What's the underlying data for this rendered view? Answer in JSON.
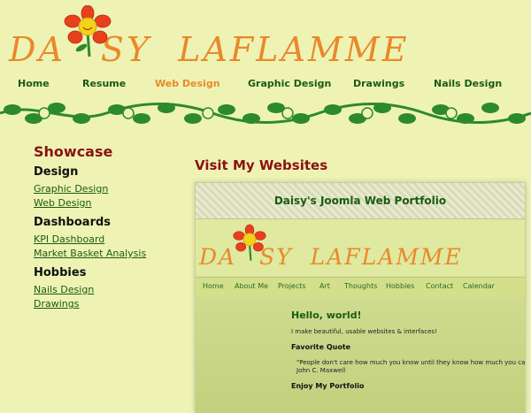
{
  "logo": {
    "part1": "DA",
    "part2": "SY",
    "part3": "LAFLAMME"
  },
  "nav": [
    {
      "label": "Home"
    },
    {
      "label": "Resume"
    },
    {
      "label": "Web Design"
    },
    {
      "label": "Graphic Design"
    },
    {
      "label": "Drawings"
    },
    {
      "label": "Nails Design"
    }
  ],
  "colors": {
    "background": "#eef3b4",
    "accent": "#e9892a",
    "link": "#1a5b12",
    "heading": "#8a1212"
  },
  "sidebar": {
    "title": "Showcase",
    "sections": [
      {
        "heading": "Design",
        "links": [
          "Graphic Design",
          "Web Design"
        ]
      },
      {
        "heading": "Dashboards",
        "links": [
          "KPI Dashboard",
          "Market Basket Analysis"
        ]
      },
      {
        "heading": "Hobbies",
        "links": [
          "Nails Design",
          "Drawings"
        ]
      }
    ]
  },
  "main": {
    "title": "Visit My Websites"
  },
  "preview": {
    "banner_title": "Daisy's Joomla Web Portfolio",
    "logo": {
      "part1": "DA",
      "part2": "SY",
      "part3": "LAFLAMME"
    },
    "nav": [
      "Home",
      "About Me",
      "Projects",
      "Art",
      "Thoughts",
      "Hobbies",
      "Contact",
      "Calendar"
    ],
    "hello": "Hello, world!",
    "intro": "I make beautiful, usable websites & interfaces!",
    "quote_heading": "Favorite Quote",
    "quote": "\"People don't care how much you know until they know how much you care.\"",
    "quote_author": "John C. Maxwell",
    "portfolio_heading": "Enjoy My Portfolio"
  }
}
